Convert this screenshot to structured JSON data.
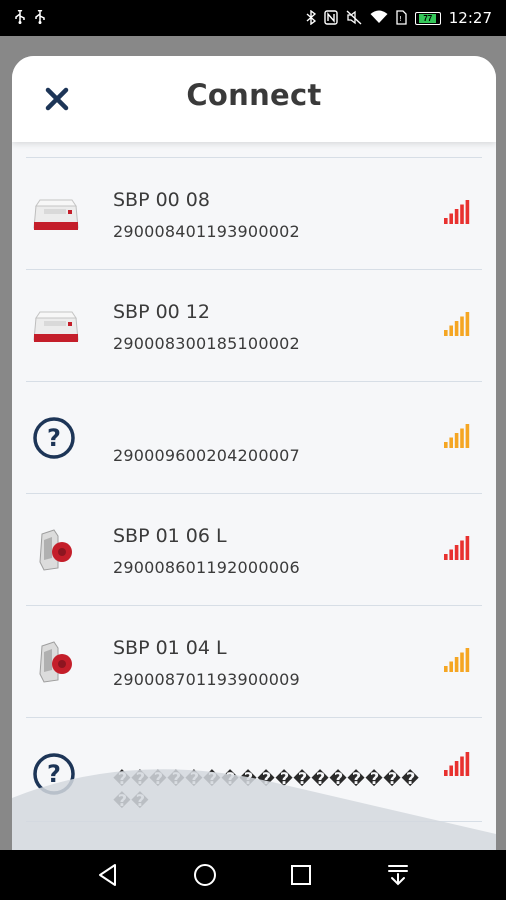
{
  "status_bar": {
    "left_icons": [
      "usb-icon",
      "usb-icon"
    ],
    "right_icons": [
      "bluetooth-icon",
      "nfc-icon",
      "mute-icon",
      "wifi-icon",
      "sim-icon"
    ],
    "battery_level": "77",
    "time": "12:27"
  },
  "modal": {
    "title": "Connect",
    "close_icon": "close-icon"
  },
  "devices": [
    {
      "name": "SBP 00 08",
      "serial": "290008401193900002",
      "icon": "charger-box-icon",
      "signal_color": "#e8312f",
      "signal_bars": 5
    },
    {
      "name": "SBP 00 12",
      "serial": "290008300185100002",
      "icon": "charger-box-icon",
      "signal_color": "#f5a623",
      "signal_bars": 5
    },
    {
      "name": "",
      "serial": "290009600204200007",
      "icon": "question-icon",
      "signal_color": "#f5a623",
      "signal_bars": 5
    },
    {
      "name": "SBP 01 06 L",
      "serial": "290008601192000006",
      "icon": "socket-plug-icon",
      "signal_color": "#e8312f",
      "signal_bars": 5
    },
    {
      "name": "SBP 01 04 L",
      "serial": "290008701193900009",
      "icon": "socket-plug-icon",
      "signal_color": "#f5a623",
      "signal_bars": 5
    },
    {
      "name": "",
      "serial": "�������������������",
      "icon": "question-icon",
      "signal_color": "#e8312f",
      "signal_bars": 5
    }
  ],
  "colors": {
    "accent": "#1d3557",
    "divider": "#d7dee6",
    "signal_red": "#e8312f",
    "signal_orange": "#f5a623"
  },
  "nav_bar": {
    "buttons": [
      "back-icon",
      "home-icon",
      "recents-icon",
      "notification-pulldown-icon"
    ]
  }
}
